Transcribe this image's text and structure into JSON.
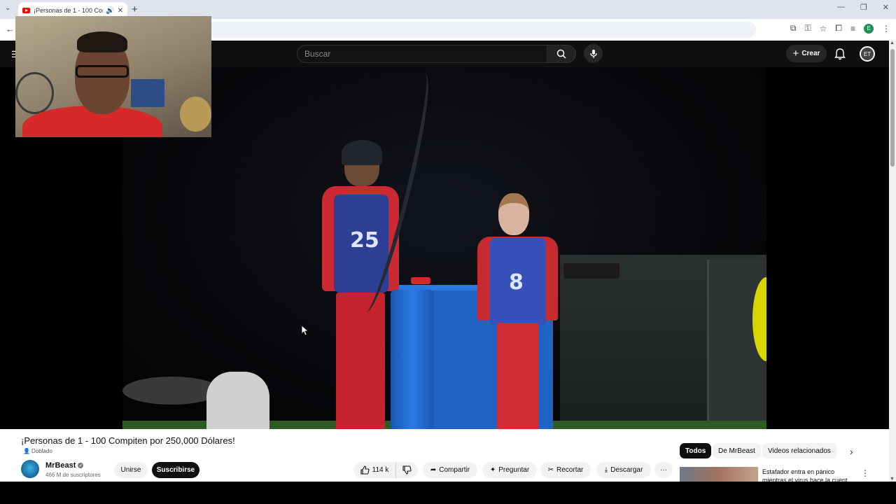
{
  "browser": {
    "tab_title": "¡Personas de 1 - 100 Compi",
    "tab_speaker": "🔊",
    "tab_close": "✕",
    "new_tab": "+",
    "profile_letter": "E"
  },
  "header": {
    "menu_icon": "☰",
    "search_placeholder": "Buscar",
    "create_label": "Crear",
    "avatar_initials": "ET"
  },
  "video": {
    "jersey_man": "25",
    "jersey_girl": "8",
    "title": "¡Personas de 1 - 100 Compiten por 250,000 Dólares!",
    "dubbed_label": "Doblado"
  },
  "channel": {
    "name": "MrBeast",
    "subscribers": "466 M de suscriptores",
    "join_label": "Unirse",
    "subscribe_label": "Suscribirse"
  },
  "actions": {
    "likes": "114 k",
    "share": "Compartir",
    "ask": "Preguntar",
    "clip": "Recortar",
    "download": "Descargar",
    "more": "···"
  },
  "chips": {
    "all": "Todos",
    "mrbeast": "De MrBeast",
    "related": "Videos relacionados"
  },
  "recommendation": {
    "title": "Estafador entra en pánico mientras el virus hace la cuent"
  },
  "colors": {
    "yt_dark": "#0f0f0f",
    "subscribe_bg": "#0f0f0f",
    "brand_red": "#ff0000"
  }
}
